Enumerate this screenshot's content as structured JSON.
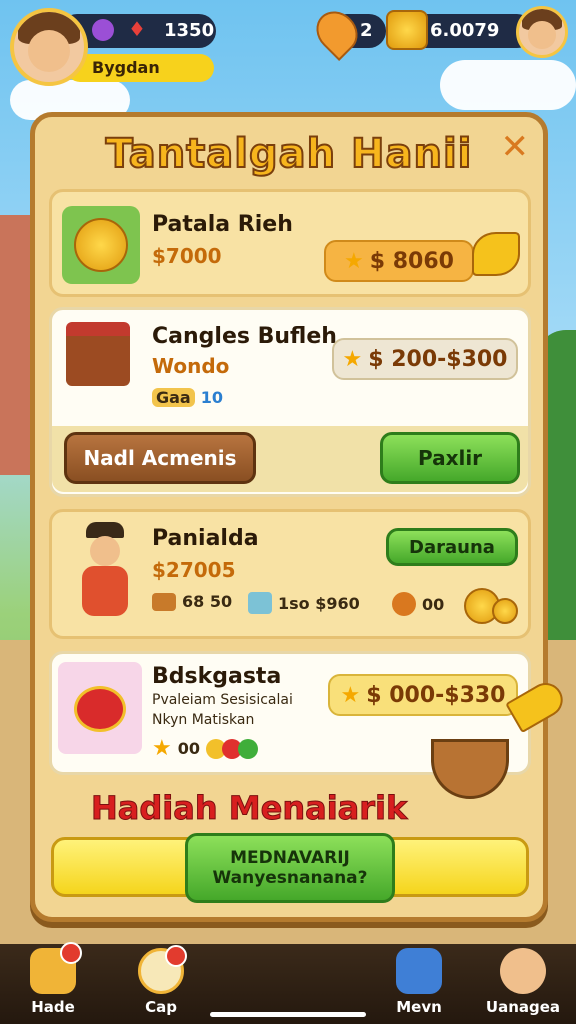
{
  "hud": {
    "gems": "1350",
    "username": "Bygdan",
    "pins": "2",
    "coins": "6.0079"
  },
  "panel": {
    "title": "Tantalgah Hanii",
    "close_icon": "close-icon"
  },
  "cards": [
    {
      "name": "Patala Rieh",
      "sub": "$7000",
      "price": "$ 8060"
    },
    {
      "name": "Cangles Bufleh",
      "sub": "Wondo",
      "detail_a": "Gaa",
      "detail_b": "10",
      "price": "$ 200-$300",
      "left_button": "Nadl Acmenis",
      "right_button": "Paxlir"
    },
    {
      "name": "Panialda",
      "sub": "$27005",
      "button": "Darauna",
      "stats": [
        "68 50",
        "1so $960",
        "00"
      ]
    },
    {
      "name": "Bdskgasta",
      "desc1": "Pvaleiam Sesisicalai",
      "desc2": "Nkyn Matiskan",
      "price": "$ 000-$330",
      "stat": "00"
    }
  ],
  "rewards_title": "Hadiah Menaiarik",
  "cta": {
    "line1": "MEDNAVARIJ",
    "line2": "Wanyesnanana?"
  },
  "nav": [
    {
      "label": "Hade",
      "icon": "dice-icon"
    },
    {
      "label": "Cap",
      "icon": "map-icon"
    },
    {
      "label": "Mevn",
      "icon": "gift-box-icon"
    },
    {
      "label": "Uanagea",
      "icon": "profile-icon"
    }
  ],
  "colors": {
    "panel": "#f2d592",
    "accent_green": "#45a82a",
    "title_gold": "#f7b51d",
    "rewards_red": "#d81f1f"
  }
}
